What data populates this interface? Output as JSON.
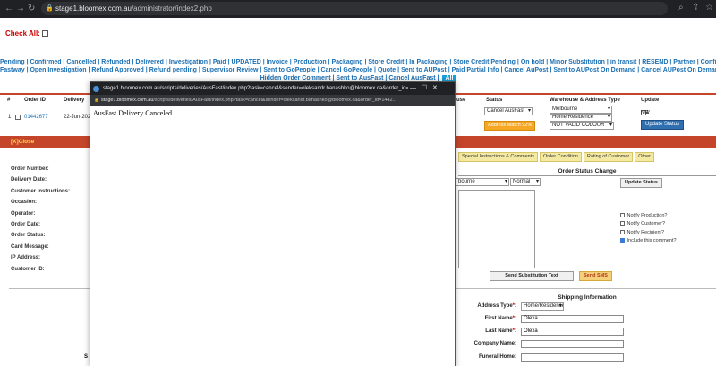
{
  "browser": {
    "url_host": "stage1.bloomex.com.au",
    "url_path": "/administrator/index2.php"
  },
  "check_all_label": "Check All:",
  "filters_line1": [
    "Pending",
    "Confirmed",
    "Cancelled",
    "Refunded",
    "Delivered",
    "Investigation",
    "Paid",
    "UPDATED",
    "Invoice",
    "Production",
    "Packaging",
    "Store Credit",
    "In Packaging",
    "Store Credit Pending",
    "On hold",
    "Minor Substitution",
    "in transit",
    "RESEND",
    "Partner",
    "Confirm Partner",
    "Cancel P"
  ],
  "filters_line2": [
    "Fastway",
    "Open Investigation",
    "Refund Approved",
    "Refund pending",
    "Supervisor Review",
    "Sent to GoPeople",
    "Cancel GoPeople",
    "Quote",
    "Sent to AUPost",
    "Paid Partial Info",
    "Cancel AuPost",
    "Sent to AUPost On Demand",
    "Cancel AUPost On Demand",
    "Sent to Couriers"
  ],
  "filters_line3": [
    "Hidden Order Comment",
    "Sent to AusFast",
    "Cancel AusFast"
  ],
  "filters_all": "All",
  "table": {
    "headers": {
      "num": "#",
      "order_id": "Order ID",
      "delivery": "Delivery",
      "status": "Status",
      "warehouse": "Warehouse & Address Type",
      "update": "Update",
      "partial": "use"
    },
    "row": {
      "num": "1",
      "order_id": "01442677",
      "delivery": "22-Jun-2023",
      "status_value": "Cancel AusFast",
      "address_match": "Address Match 92%",
      "warehouse": "Melbourne",
      "address_type": "Home/Residence",
      "colour": "NOT VALID COLOUR",
      "check_labels": [
        "N/C",
        "N/W",
        "N/R"
      ],
      "update_button": "Update Status"
    }
  },
  "close_label": "[X]Close",
  "tabs": [
    "Special Instructions & Comments",
    "Order Condition",
    "Rating of Customer",
    "Other"
  ],
  "order_fields": [
    "Order Number:",
    "Delivery Date:",
    "Customer Instructions:",
    "Occasion:",
    "Operator:",
    "Order Date:",
    "Order Status:",
    "Card Message:",
    "IP Address:",
    "Customer ID:"
  ],
  "status_change": {
    "title": "Order Status Change",
    "warehouse_value": "bourne",
    "priority_value": "Normal",
    "update_button": "Update Status",
    "notify": [
      {
        "label": "Notify Production?",
        "checked": false
      },
      {
        "label": "Notify Customer?",
        "checked": false
      },
      {
        "label": "Notify Recipient?",
        "checked": false
      },
      {
        "label": "Include this comment?",
        "checked": true
      }
    ],
    "substitution_button": "Send Substitution Text",
    "sms_button": "Send SMS"
  },
  "shipping": {
    "title": "Shipping Information",
    "address_type_label": "Address Type",
    "address_type_value": "Home/Residence",
    "first_name_label": "First Name",
    "first_name_value": "Olexa",
    "last_name_label": "Last Name",
    "last_name_value": "Olexa",
    "company_label": "Company Name:",
    "company_value": "",
    "funeral_label": "Funeral Home:",
    "funeral_value": "",
    "left_partial": "S"
  },
  "popup": {
    "title": "stage1.bloomex.com.au/scripts/deliveries/AusFast/index.php?task=cancel&sender=oleksandr.banashko@bloomex.ca&order_id=1442677...",
    "addr_host": "stage1.bloomex.com.au",
    "addr_path": "/scripts/deliveries/AusFast/index.php?task=cancel&sender=oleksandr.banashko@bloomex.ca&order_id=1442...",
    "body": "AusFast Delivery Canceled"
  }
}
